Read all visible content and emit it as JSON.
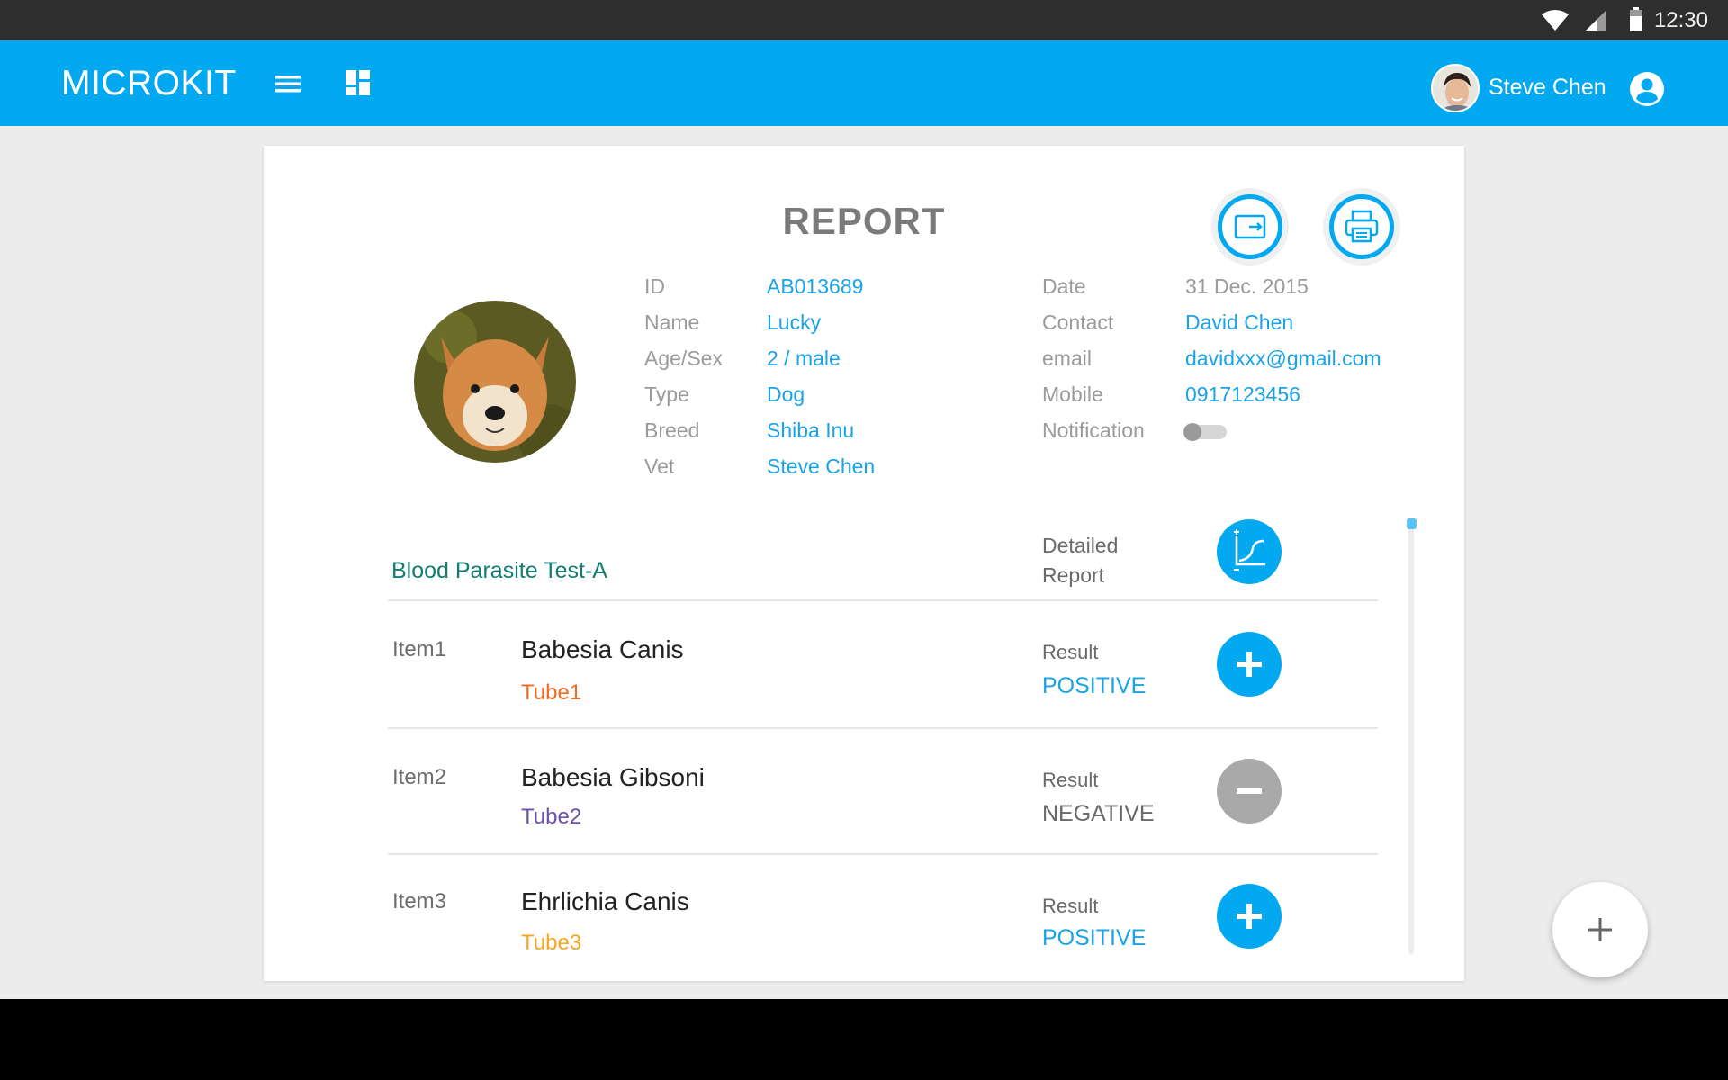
{
  "status_bar": {
    "time": "12:30",
    "icons": [
      "wifi-icon",
      "signal-icon",
      "battery-icon"
    ]
  },
  "app_bar": {
    "brand": "MICROKIT",
    "icons": [
      "menu-icon",
      "dashboard-icon",
      "account-icon"
    ],
    "user_name": "Steve Chen"
  },
  "report": {
    "title": "REPORT",
    "actions": [
      "export-icon",
      "print-icon"
    ],
    "patient": {
      "id_label": "ID",
      "id": "AB013689",
      "name_label": "Name",
      "name": "Lucky",
      "age_sex_label": "Age/Sex",
      "age_sex": "2 / male",
      "type_label": "Type",
      "type": "Dog",
      "breed_label": "Breed",
      "breed": "Shiba Inu",
      "vet_label": "Vet",
      "vet": "Steve Chen"
    },
    "owner": {
      "date_label": "Date",
      "date": "31 Dec. 2015",
      "contact_label": "Contact",
      "contact": "David Chen",
      "email_label": "email",
      "email": "davidxxx@gmail.com",
      "mobile_label": "Mobile",
      "mobile": "0917123456",
      "notification_label": "Notification",
      "notification_on": false
    },
    "test": {
      "name": "Blood Parasite Test-A",
      "detailed_line1": "Detailed",
      "detailed_line2": "Report"
    },
    "items": [
      {
        "label": "Item1",
        "name": "Babesia Canis",
        "tube": "Tube1",
        "tube_color": "#f26a21",
        "result_label": "Result",
        "result": "POSITIVE",
        "result_color": "#1ba3e8"
      },
      {
        "label": "Item2",
        "name": "Babesia Gibsoni",
        "tube": "Tube2",
        "tube_color": "#6a52a8",
        "result_label": "Result",
        "result": "NEGATIVE",
        "result_color": "#6a6a6a"
      },
      {
        "label": "Item3",
        "name": "Ehrlichia Canis",
        "tube": "Tube3",
        "tube_color": "#f5a623",
        "result_label": "Result",
        "result": "POSITIVE",
        "result_color": "#1ba3e8"
      }
    ]
  },
  "colors": {
    "primary": "#03a9f0",
    "status_bar": "#2e2e2e",
    "accent_text": "#1ba3e8",
    "test_name": "#137d74"
  }
}
